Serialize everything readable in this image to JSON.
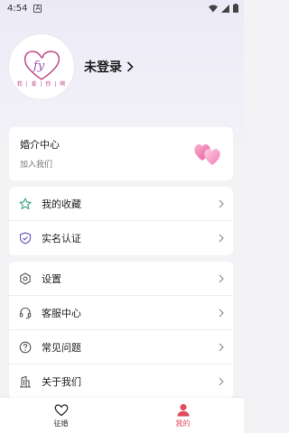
{
  "status_bar": {
    "time": "4:54",
    "a_icon": "A"
  },
  "profile": {
    "logo_text": "fy",
    "logo_sub": "我 | 爱 | 你 | 啊",
    "login_label": "未登录"
  },
  "matchmaker": {
    "title": "婚介中心",
    "subtitle": "加入我们"
  },
  "group1": [
    {
      "label": "我的收藏",
      "icon": "star-icon"
    },
    {
      "label": "实名认证",
      "icon": "shield-icon"
    }
  ],
  "group2": [
    {
      "label": "设置",
      "icon": "settings-icon"
    },
    {
      "label": "客服中心",
      "icon": "headset-icon"
    },
    {
      "label": "常见问题",
      "icon": "question-icon"
    },
    {
      "label": "关于我们",
      "icon": "building-icon"
    }
  ],
  "bottom_nav": {
    "items": [
      {
        "label": "征婚",
        "icon": "heart-outline-icon",
        "active": false
      },
      {
        "label": "我的",
        "icon": "user-icon",
        "active": true
      }
    ]
  },
  "colors": {
    "accent": "#e04d5c",
    "icon_gray": "#555555",
    "star_green": "#4aa88c",
    "shield_purple": "#6f5bbf",
    "logo_pink": "#c0518a"
  }
}
